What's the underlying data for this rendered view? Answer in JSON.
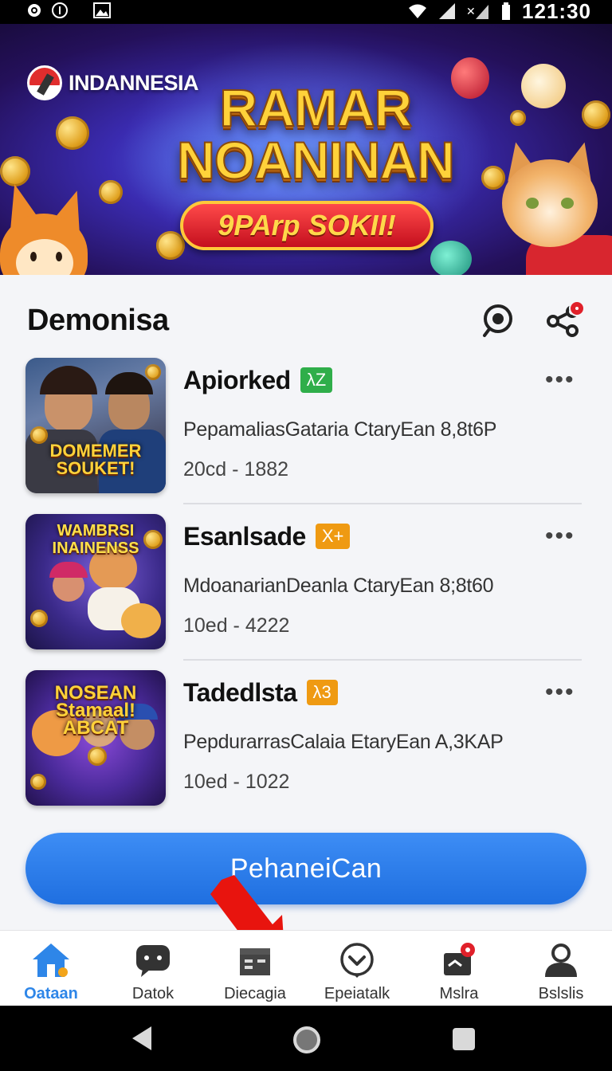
{
  "status_bar": {
    "time": "121:30",
    "left_icons": [
      "gear-icon",
      "info-icon",
      "image-icon"
    ],
    "right_icons": [
      "wifi-icon",
      "signal-icon",
      "mute-icon",
      "battery-icon"
    ]
  },
  "banner": {
    "brand": "INDANNESIA",
    "headline": [
      "RAMAR",
      "NOANINAN"
    ],
    "pill": "9PArp SOKII!"
  },
  "section": {
    "title": "Demonisa"
  },
  "items": [
    {
      "title": "Apiorked",
      "badge": "λZ",
      "badge_color": "#2fae4a",
      "subtitle": "PepamaliasGataria CtaryEan 8,8t6P",
      "meta": "20cd - 1882",
      "thumb_text": "DOMEMER SOUKET!"
    },
    {
      "title": "Esanlsade",
      "badge": "X+",
      "badge_color": "#ef9a12",
      "subtitle": "MdoanarianDeanla CtaryEan 8;8t60",
      "meta": "10ed - 4222",
      "thumb_text": "WAMBRSI INAINENSS"
    },
    {
      "title": "Tadedlsta",
      "badge": "λ3",
      "badge_color": "#ef9a12",
      "subtitle": "PepdurarrasCalaia EtaryEan A,3KAP",
      "meta": "10ed - 1022",
      "thumb_text": "NOSEAN Stamaal! ABCAT"
    }
  ],
  "cta": {
    "label": "PehaneiCan"
  },
  "bottom_nav": [
    {
      "label": "Oataan",
      "icon": "home-icon",
      "active": true
    },
    {
      "label": "Datok",
      "icon": "chat-icon",
      "active": false
    },
    {
      "label": "Diecagia",
      "icon": "store-icon",
      "active": false
    },
    {
      "label": "Epeiatalk",
      "icon": "heart-badge-icon",
      "active": false
    },
    {
      "label": "Mslra",
      "icon": "inbox-icon",
      "active": false
    },
    {
      "label": "Bslslis",
      "icon": "profile-icon",
      "active": false
    }
  ],
  "colors": {
    "accent": "#2e86e8",
    "cta": "#1f6fe0",
    "arrow": "#e8140e"
  }
}
